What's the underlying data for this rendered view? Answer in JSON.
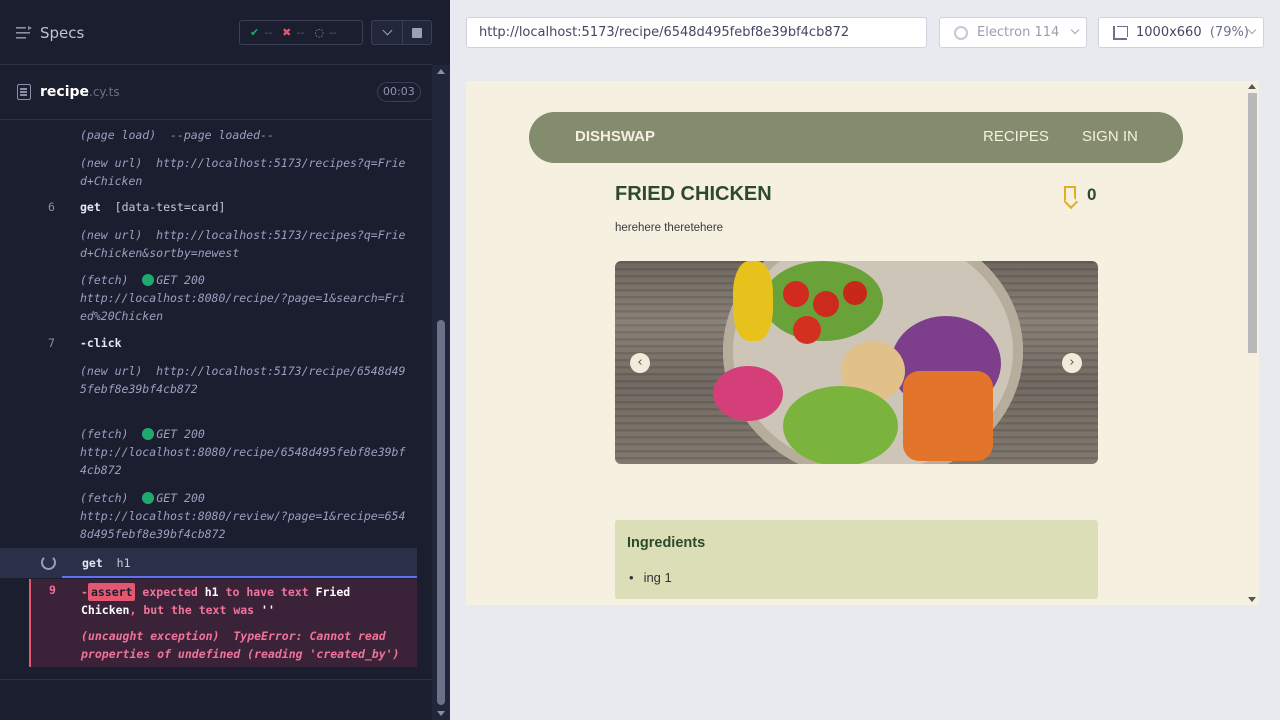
{
  "runner": {
    "specs_label": "Specs",
    "stats": {
      "passed": "--",
      "failed": "--",
      "pending": "--"
    },
    "spec_file": {
      "name": "recipe",
      "ext": ".cy.ts",
      "duration": "00:03"
    },
    "log": [
      {
        "num": "",
        "type": "(page load)",
        "text": "--page loaded--"
      },
      {
        "num": "",
        "type": "(new url)",
        "text": "http://localhost:5173/recipes?q=Fried+Chicken"
      },
      {
        "num": "6",
        "name": "get",
        "text": "[data-test=card]"
      },
      {
        "num": "",
        "type": "(new url)",
        "text": "http://localhost:5173/recipes?q=Fried+Chicken&sortby=newest"
      },
      {
        "num": "",
        "type": "(fetch)",
        "method": "GET 200",
        "text": "http://localhost:8080/recipe/?page=1&search=Fried%20Chicken"
      },
      {
        "num": "7",
        "name": "-click",
        "text": ""
      },
      {
        "num": "",
        "type": "(new url)",
        "text": "http://localhost:5173/recipe/6548d495febf8e39bf4cb872"
      },
      {
        "num": "",
        "type": "(fetch)",
        "method": "GET 200",
        "text": "http://localhost:8080/recipe/6548d495febf8e39bf4cb872"
      },
      {
        "num": "",
        "type": "(fetch)",
        "method": "GET 200",
        "text": "http://localhost:8080/review/?page=1&recipe=6548d495febf8e39bf4cb872"
      }
    ],
    "active": {
      "name": "get",
      "text": "h1"
    },
    "error": {
      "num": "9",
      "badge": "assert",
      "msg_a": "expected",
      "subject": "h1",
      "msg_b": "to have text",
      "expected": "Fried Chicken",
      "msg_c": ", but the text was",
      "actual": "''",
      "exception_type": "(uncaught exception)",
      "exception_text": "TypeError: Cannot read properties of undefined (reading 'created_by')"
    }
  },
  "browser": {
    "url": "http://localhost:5173/recipe/6548d495febf8e39bf4cb872",
    "engine": "Electron 114",
    "viewport": "1000x660",
    "zoom": "(79%)"
  },
  "app": {
    "brand": "DISHSWAP",
    "nav": {
      "recipes": "RECIPES",
      "signin": "SIGN IN"
    },
    "recipe": {
      "title": "FRIED CHICKEN",
      "bookmarks": "0",
      "description": "herehere theretehere"
    },
    "carousel": {
      "prev": "‹",
      "next": "›"
    },
    "ingredients": {
      "title": "Ingredients",
      "items": [
        "ing 1"
      ]
    }
  },
  "colors": {
    "runner_bg": "#1b1e2e",
    "pass": "#1fa971",
    "fail": "#e45770",
    "nav_bg": "#848c6e",
    "page_bg": "#f6f0e0",
    "ingredients_bg": "#dcdeb8",
    "bookmark": "#e0b020"
  },
  "icons": [
    "list-icon",
    "check-icon",
    "x-icon",
    "spinner-icon",
    "chevron-down-icon",
    "stop-icon",
    "file-icon",
    "browser-icon",
    "ruler-icon",
    "bookmark-icon",
    "chevron-left-icon",
    "chevron-right-icon"
  ]
}
